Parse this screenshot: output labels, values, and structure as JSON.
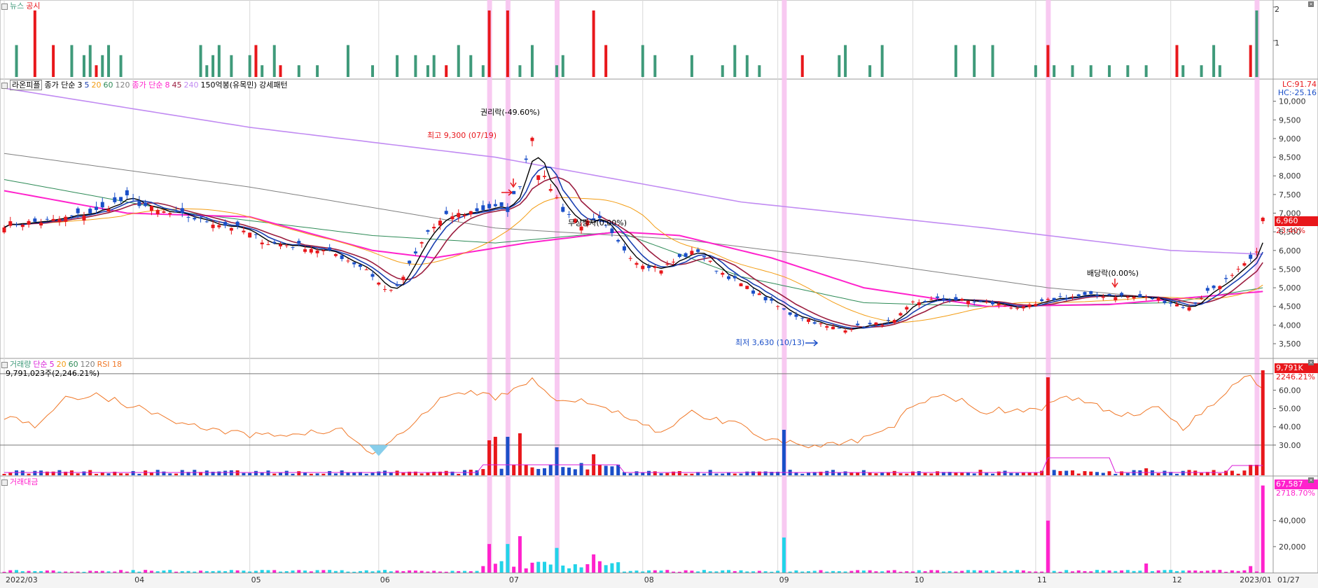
{
  "colors": {
    "up": "#e8171b",
    "down": "#1a4fc8",
    "news": "#3f9a7a",
    "disclosure": "#e8171b",
    "highlight": "#f7c3ef",
    "ma3": "#000000",
    "ma5": "#1a3fb0",
    "ma20": "#f39c12",
    "ma60": "#2e8b57",
    "ma120": "#808080",
    "ma_pink8": "#ff22cc",
    "ma45": "#9b1d3f",
    "ma240": "#c18bf2",
    "rsi": "#f07828",
    "volume_ma": "#d81bd8",
    "amount_up": "#ff22cc",
    "amount_down": "#22d3e8"
  },
  "news_pane": {
    "legend": {
      "news": "뉴스",
      "disclosure": "공시"
    },
    "axis": {
      "top": "2",
      "mid": "1"
    }
  },
  "price_pane": {
    "legend": {
      "name": "라온피플",
      "ma_label": "종가 단순",
      "ma3": "3",
      "ma5": "5",
      "ma20": "20",
      "ma60": "60",
      "ma120": "120",
      "ma2_label": "종가 단순",
      "ma8": "8",
      "ma45": "45",
      "ma240": "240",
      "pattern": "150억봉(유목민) 강세패턴"
    },
    "lc": "LC:91.74",
    "hc": "HC:-25.16",
    "last_price": "6,960",
    "last_change": "23.40%",
    "annotations": {
      "rights": "권리락(-49.60%)",
      "high": "최고 9,300 (07/19)",
      "bonus": "무상증자(0.00%)",
      "dividend": "배당락(0.00%)",
      "low": "최저 3,630 (10/13)"
    }
  },
  "volume_pane": {
    "legend": {
      "volume": "거래량",
      "ma_label": "단순",
      "ma5": "5",
      "ma20": "20",
      "ma60": "60",
      "ma120": "120",
      "rsi": "RSI 18"
    },
    "current": "9,791,023주(2,246.21%)",
    "last_vol": "9,791K",
    "last_pct": "2246.21%"
  },
  "amount_pane": {
    "legend": {
      "amount": "거래대금"
    },
    "last_amt": "67,587",
    "last_pct": "2718.70%"
  },
  "x_labels": [
    "2022/03",
    "04",
    "05",
    "06",
    "07",
    "08",
    "09",
    "10",
    "11",
    "12",
    "2023/01",
    "01/27"
  ],
  "chart_data": {
    "type": "candlestick",
    "symbol": "라온피플",
    "price_ticks": [
      3500,
      4000,
      4500,
      5000,
      5500,
      6000,
      6500,
      7000,
      7500,
      8000,
      8500,
      9000,
      9500,
      10000
    ],
    "price_tick_labels": [
      "3,500",
      "4,000",
      "4,500",
      "5,000",
      "5,500",
      "6,000",
      "6,500",
      "7,000",
      "7,500",
      "8,000",
      "8,500",
      "9,000",
      "9,500",
      "10,000"
    ],
    "rsi_ticks": [
      30,
      40,
      50,
      60
    ],
    "rsi_tick_labels": [
      "30.00",
      "40.00",
      "50.00",
      "60.00"
    ],
    "amount_ticks": [
      20000,
      40000
    ],
    "amount_tick_labels": [
      "20,000",
      "40,000"
    ],
    "price_path": [
      [
        0,
        6700
      ],
      [
        8,
        6800
      ],
      [
        15,
        7050
      ],
      [
        20,
        7400
      ],
      [
        25,
        7050
      ],
      [
        30,
        6900
      ],
      [
        38,
        6600
      ],
      [
        43,
        6200
      ],
      [
        49,
        6100
      ],
      [
        54,
        5900
      ],
      [
        59,
        5500
      ],
      [
        62,
        4950
      ],
      [
        64,
        5000
      ],
      [
        66,
        5600
      ],
      [
        69,
        6500
      ],
      [
        72,
        6900
      ],
      [
        75,
        7000
      ],
      [
        79,
        7150
      ],
      [
        82,
        7100
      ],
      [
        84,
        7800
      ],
      [
        86,
        9100
      ],
      [
        87,
        8100
      ],
      [
        89,
        7700
      ],
      [
        91,
        7100
      ],
      [
        94,
        6700
      ],
      [
        97,
        6800
      ],
      [
        100,
        6200
      ],
      [
        103,
        5700
      ],
      [
        107,
        5500
      ],
      [
        110,
        5800
      ],
      [
        113,
        6000
      ],
      [
        116,
        5500
      ],
      [
        120,
        5100
      ],
      [
        124,
        4700
      ],
      [
        128,
        4300
      ],
      [
        131,
        4150
      ],
      [
        134,
        3950
      ],
      [
        137,
        3900
      ],
      [
        140,
        3980
      ],
      [
        145,
        4100
      ],
      [
        148,
        4600
      ],
      [
        153,
        4700
      ],
      [
        160,
        4600
      ],
      [
        166,
        4450
      ],
      [
        172,
        4750
      ],
      [
        180,
        4800
      ],
      [
        188,
        4700
      ],
      [
        193,
        4450
      ],
      [
        196,
        4900
      ],
      [
        200,
        5300
      ],
      [
        204,
        5900
      ],
      [
        205,
        6960
      ]
    ],
    "ma240": [
      [
        0,
        10350
      ],
      [
        40,
        9300
      ],
      [
        80,
        8500
      ],
      [
        120,
        7300
      ],
      [
        160,
        6600
      ],
      [
        190,
        6000
      ],
      [
        205,
        5900
      ]
    ],
    "ma120": [
      [
        0,
        8600
      ],
      [
        40,
        7700
      ],
      [
        80,
        6600
      ],
      [
        110,
        6300
      ],
      [
        140,
        5700
      ],
      [
        170,
        5000
      ],
      [
        190,
        4700
      ],
      [
        205,
        4900
      ]
    ],
    "ma60": [
      [
        0,
        7900
      ],
      [
        30,
        7000
      ],
      [
        60,
        6400
      ],
      [
        80,
        6200
      ],
      [
        100,
        6500
      ],
      [
        120,
        5300
      ],
      [
        140,
        4600
      ],
      [
        160,
        4500
      ],
      [
        190,
        4600
      ],
      [
        205,
        5000
      ]
    ],
    "ma_pink8": [
      [
        0,
        7600
      ],
      [
        20,
        7000
      ],
      [
        40,
        6900
      ],
      [
        60,
        6000
      ],
      [
        70,
        5800
      ],
      [
        85,
        6200
      ],
      [
        100,
        6500
      ],
      [
        110,
        6400
      ],
      [
        125,
        5800
      ],
      [
        140,
        5000
      ],
      [
        160,
        4500
      ],
      [
        180,
        4550
      ],
      [
        205,
        4900
      ]
    ],
    "events": [
      {
        "label": "권리락(-49.60%)"
      },
      {
        "label": "최고 9,300 (07/19)",
        "value": 9300
      },
      {
        "label": "무상증자(0.00%)"
      },
      {
        "label": "배당락(0.00%)"
      },
      {
        "label": "최저 3,630 (10/13)",
        "value": 3630
      }
    ]
  }
}
